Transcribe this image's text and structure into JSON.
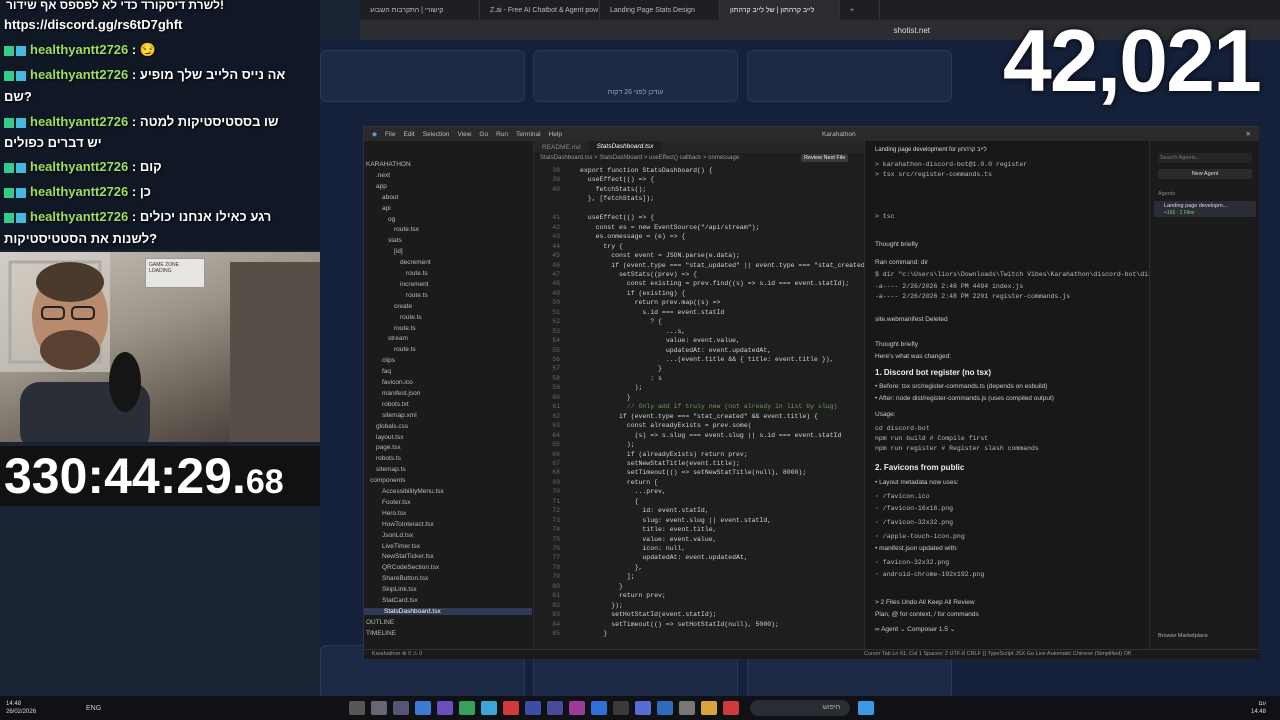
{
  "browser": {
    "tabs": [
      "קישורי | התקרבות השבוע",
      "Z.ai - Free AI Chatbot & Agent pow",
      "Landing Page Stats Design",
      "לייב קרהתון | של לייב קרהתון",
      ""
    ],
    "url": "shotist.net"
  },
  "background_page": {
    "card_text": "עודכן לפני 26 דקות"
  },
  "big_counter": "42,021",
  "chat": {
    "header": "לשרת דיסקורד כדי לא לפספס אף שידור!",
    "link": "https://discord.gg/rs6tD7ghft",
    "messages": [
      {
        "user": "healthyantt2726",
        "text": ": 😏"
      },
      {
        "user": "healthyantt2726",
        "text": ": אה נייס הלייב שלך מופיע"
      },
      {
        "user": "",
        "text": "שם?"
      },
      {
        "user": "healthyantt2726",
        "text": ": שו בססטיסטיקות למטה"
      },
      {
        "user": "",
        "text": "יש דברים כפולים"
      },
      {
        "user": "healthyantt2726",
        "text": ": קום"
      },
      {
        "user": "healthyantt2726",
        "text": ": כן"
      },
      {
        "user": "healthyantt2726",
        "text": ": רגע כאילו אנחנו יכולים"
      },
      {
        "user": "",
        "text": "לשנות את הסטטיסטיקות?"
      }
    ]
  },
  "webcam": {
    "sign_line1": "GAME ZONE",
    "sign_line2": "LOADING"
  },
  "timer": {
    "main": "330:44:29.",
    "fraction": "68"
  },
  "ide": {
    "menu": [
      "File",
      "Edit",
      "Selection",
      "View",
      "Go",
      "Run",
      "Terminal",
      "Help"
    ],
    "title": "Karahathon",
    "tabs": [
      "README.md",
      "StatsDashboard.tsx"
    ],
    "breadcrumb": "StatsDashboard.tsx > StatsDashboard > useEffect() callback > onmessage",
    "review_button": "Review Next File",
    "explorer": [
      "KARAHATHON",
      ".next",
      "app",
      "about",
      "api",
      "og",
      "route.tsx",
      "stats",
      "[id]",
      "decrement",
      "route.ts",
      "increment",
      "route.ts",
      "create",
      "route.ts",
      "route.ts",
      "stream",
      "route.ts",
      "clips",
      "faq",
      "favicon.ico",
      "manifest.json",
      "robots.txt",
      "sitemap.xml",
      "globals.css",
      "layout.tsx",
      "page.tsx",
      "robots.ts",
      "sitemap.ts",
      "components",
      "AccessibilityMenu.tsx",
      "Footer.tsx",
      "Hero.tsx",
      "HowToInteract.tsx",
      "JsonLd.tsx",
      "LiveTimer.tsx",
      "NewStatTicker.tsx",
      "QRCodeSection.tsx",
      "ShareButton.tsx",
      "SkipLink.tsx",
      "StatCard.tsx",
      "StatsDashboard.tsx",
      "OUTLINE",
      "TIMELINE"
    ],
    "code_lines": [
      {
        "n": "38",
        "t": "export function StatsDashboard() {"
      },
      {
        "n": "39",
        "t": "  useEffect(() => {"
      },
      {
        "n": "40",
        "t": "    fetchStats();"
      },
      {
        "n": "",
        "t": "  }, [fetchStats]);"
      },
      {
        "n": "",
        "t": ""
      },
      {
        "n": "41",
        "t": "  useEffect(() => {"
      },
      {
        "n": "42",
        "t": "    const es = new EventSource(\"/api/stream\");"
      },
      {
        "n": "43",
        "t": "    es.onmessage = (e) => {"
      },
      {
        "n": "44",
        "t": "      try {"
      },
      {
        "n": "45",
        "t": "        const event = JSON.parse(e.data);"
      },
      {
        "n": "46",
        "t": "        if (event.type === \"stat_updated\" || event.type === \"stat_created\") {"
      },
      {
        "n": "47",
        "t": "          setStats((prev) => {"
      },
      {
        "n": "48",
        "t": "            const existing = prev.find((s) => s.id === event.statId);"
      },
      {
        "n": "49",
        "t": "            if (existing) {"
      },
      {
        "n": "50",
        "t": "              return prev.map((s) =>"
      },
      {
        "n": "51",
        "t": "                s.id === event.statId"
      },
      {
        "n": "52",
        "t": "                  ? {"
      },
      {
        "n": "53",
        "t": "                      ...s,"
      },
      {
        "n": "54",
        "t": "                      value: event.value,"
      },
      {
        "n": "55",
        "t": "                      updatedAt: event.updatedAt,"
      },
      {
        "n": "56",
        "t": "                      ...(event.title && { title: event.title }),"
      },
      {
        "n": "57",
        "t": "                    }"
      },
      {
        "n": "58",
        "t": "                  : s"
      },
      {
        "n": "59",
        "t": "              );"
      },
      {
        "n": "60",
        "t": "            }"
      },
      {
        "n": "61",
        "t": "            // Only add if truly new (not already in list by slug)"
      },
      {
        "n": "62",
        "t": "          if (event.type === \"stat_created\" && event.title) {"
      },
      {
        "n": "63",
        "t": "            const alreadyExists = prev.some("
      },
      {
        "n": "64",
        "t": "              (s) => s.slug === event.slug || s.id === event.statId"
      },
      {
        "n": "65",
        "t": "            );"
      },
      {
        "n": "66",
        "t": "            if (alreadyExists) return prev;"
      },
      {
        "n": "67",
        "t": "            setNewStatTitle(event.title);"
      },
      {
        "n": "68",
        "t": "            setTimeout(() => setNewStatTitle(null), 8000);"
      },
      {
        "n": "69",
        "t": "            return ["
      },
      {
        "n": "70",
        "t": "              ...prev,"
      },
      {
        "n": "71",
        "t": "              {"
      },
      {
        "n": "72",
        "t": "                id: event.statId,"
      },
      {
        "n": "73",
        "t": "                slug: event.slug || event.statId,"
      },
      {
        "n": "74",
        "t": "                title: event.title,"
      },
      {
        "n": "75",
        "t": "                value: event.value,"
      },
      {
        "n": "76",
        "t": "                icon: null,"
      },
      {
        "n": "77",
        "t": "                updatedAt: event.updatedAt,"
      },
      {
        "n": "78",
        "t": "              },"
      },
      {
        "n": "79",
        "t": "            ];"
      },
      {
        "n": "80",
        "t": "          }"
      },
      {
        "n": "81",
        "t": "          return prev;"
      },
      {
        "n": "82",
        "t": "        });"
      },
      {
        "n": "83",
        "t": "        setHotStatId(event.statId);"
      },
      {
        "n": "84",
        "t": "        setTimeout(() => setHotStatId(null), 5000);"
      },
      {
        "n": "85",
        "t": "      }"
      }
    ],
    "agent": {
      "title": "Landing page development for לייב קרהתון",
      "lines": [
        {
          "cls": "mono",
          "t": "> karahathon-discord-bot@1.0.0 register"
        },
        {
          "cls": "mono",
          "t": "> tsx src/register-commands.ts"
        },
        {
          "cls": "mono",
          "t": "> tsc"
        },
        {
          "cls": "",
          "t": "Thought briefly"
        },
        {
          "cls": "",
          "t": "Ran command: dir"
        },
        {
          "cls": "mono",
          "t": "$ dir \"c:\\Users\\liors\\Downloads\\Twitch Vibes\\Karahathon\\discord-bot\\dist\""
        },
        {
          "cls": "mono",
          "t": "-a----     2/26/2026   2:48 PM        4494 index.js"
        },
        {
          "cls": "mono",
          "t": "-a----     2/26/2026   2:48 PM        2201 register-commands.js"
        },
        {
          "cls": "",
          "t": "site.webmanifest  Deleted"
        },
        {
          "cls": "",
          "t": "Thought briefly"
        },
        {
          "cls": "",
          "t": "Here's what was changed:"
        },
        {
          "cls": "h",
          "t": "1. Discord bot register (no tsx)"
        },
        {
          "cls": "",
          "t": "• Before: tsx src/register-commands.ts (depends on esbuild)"
        },
        {
          "cls": "",
          "t": "• After: node dist/register-commands.js (uses compiled output)"
        },
        {
          "cls": "",
          "t": "Usage:"
        },
        {
          "cls": "mono",
          "t": "cd discord-bot"
        },
        {
          "cls": "mono",
          "t": "npm run build      # Compile first"
        },
        {
          "cls": "mono",
          "t": "npm run register   # Register slash commands"
        },
        {
          "cls": "h",
          "t": "2. Favicons from public"
        },
        {
          "cls": "",
          "t": "• Layout metadata now uses:"
        },
        {
          "cls": "mono",
          "t": "    ◦ /favicon.ico"
        },
        {
          "cls": "mono",
          "t": "    ◦ /favicon-16x16.png"
        },
        {
          "cls": "mono",
          "t": "    ◦ /favicon-32x32.png"
        },
        {
          "cls": "mono",
          "t": "    ◦ /apple-touch-icon.png"
        },
        {
          "cls": "",
          "t": "• manifest.json updated with:"
        },
        {
          "cls": "mono",
          "t": "    ◦ favicon-32x32.png"
        },
        {
          "cls": "mono",
          "t": "    ◦ android-chrome-192x192.png"
        },
        {
          "cls": "",
          "t": "> 2 Files                                   Undo All   Keep All   Review"
        },
        {
          "cls": "",
          "t": "Plan, @ for context, / for commands"
        },
        {
          "cls": "",
          "t": "∞ Agent ⌄   Composer 1.5 ⌄"
        }
      ]
    },
    "agents_panel": {
      "search": "Search Agents...",
      "new_agent": "New Agent",
      "heading": "Agents",
      "item": "Landing page developm...",
      "item_meta": "+165 · 2 Files",
      "browse": "Browse Marketplace"
    },
    "status": "Karahathon   ⊗ 0 ⚠ 0",
    "status_right": "Cursor Tab   Ln 61, Col 1   Spaces: 2   UTF-8   CRLF   {} TypeScript JSX   Go Live   Automatic   Chinese (Simplified)   Off"
  },
  "taskbar": {
    "time": "14:48",
    "date": "26/02/2026",
    "lang": "ENG",
    "search": "חיפוש",
    "right_time": "14:48",
    "right_label": "עם"
  },
  "colors": {
    "accent": "#4ea1ff",
    "chat_user": "#9be05a",
    "badge": "#33cc88"
  }
}
